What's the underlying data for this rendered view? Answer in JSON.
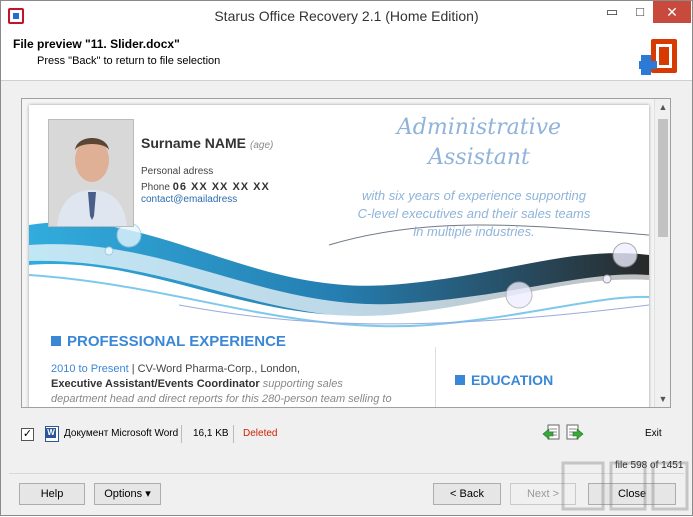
{
  "window": {
    "title": "Starus Office Recovery 2.1 (Home Edition)",
    "minimize_glyph": "▭",
    "maximize_glyph": "□",
    "close_glyph": "✕",
    "accent_color": "#c74a3c"
  },
  "header": {
    "title": "File preview \"11. Slider.docx\"",
    "subtitle": "Press \"Back\" to return to file selection",
    "logo_icon": "office-logo-icon"
  },
  "preview": {
    "resume": {
      "name": "Surname NAME",
      "age": "(age)",
      "address": "Personal adress",
      "phone_label": "Phone",
      "phone_number": "06 XX XX XX XX",
      "email": "contact@emailadress",
      "job_title_line1": "Administrative",
      "job_title_line2": "Assistant",
      "tagline_line1": "with six years of experience supporting",
      "tagline_line2": "C-level executives and their sales teams",
      "tagline_line3": "in multiple industries.",
      "experience_heading": "PROFESSIONAL EXPERIENCE",
      "exp_period": "2010 to Present",
      "exp_company": "| CV-Word Pharma-Corp., London,",
      "exp_role": "Executive Assistant/Events Coordinator",
      "exp_role_desc": "supporting sales",
      "exp_desc_line": "department head and direct reports for this 280-person team selling to",
      "education_heading": "EDUCATION"
    },
    "scroll_up_glyph": "▲",
    "scroll_down_glyph": "▼"
  },
  "file": {
    "checked": "✓",
    "type": "Документ Microsoft Word",
    "size": "16,1 KB",
    "status": "Deleted",
    "status_color": "#cc2200",
    "prev_icon": "previous-file-icon",
    "next_icon": "next-file-icon",
    "exit_label": "Exit",
    "counter": "file 598 of 1451"
  },
  "buttons": {
    "help": "Help",
    "options": "Options ▾",
    "back": "< Back",
    "next": "Next >",
    "close": "Close"
  }
}
